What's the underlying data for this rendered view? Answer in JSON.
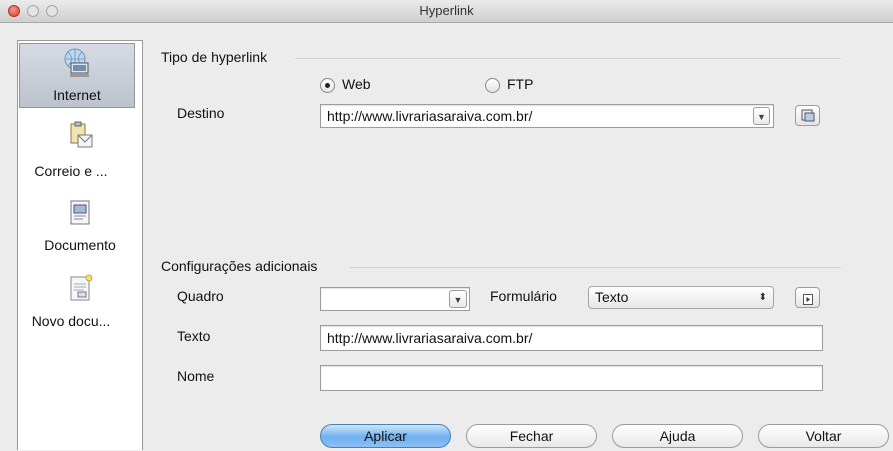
{
  "window": {
    "title": "Hyperlink"
  },
  "sidebar": {
    "items": [
      {
        "label": "Internet",
        "icon": "globe-computer-icon",
        "selected": true
      },
      {
        "label": "Correio e ...",
        "icon": "mail-clipboard-icon",
        "selected": false
      },
      {
        "label": "Documento",
        "icon": "document-icon",
        "selected": false
      },
      {
        "label": "Novo docu...",
        "icon": "new-document-icon",
        "selected": false
      }
    ]
  },
  "hyperlink_type": {
    "section_label": "Tipo de hyperlink",
    "options": [
      {
        "label": "Web",
        "selected": true
      },
      {
        "label": "FTP",
        "selected": false
      }
    ],
    "destination_label": "Destino",
    "destination_value": "http://www.livrariasaraiva.com.br/"
  },
  "additional": {
    "section_label": "Configurações adicionais",
    "frame_label": "Quadro",
    "frame_value": "",
    "form_label": "Formulário",
    "form_value": "Texto",
    "text_label": "Texto",
    "text_value": "http://www.livrariasaraiva.com.br/",
    "name_label": "Nome",
    "name_value": ""
  },
  "buttons": {
    "apply": "Aplicar",
    "close": "Fechar",
    "help": "Ajuda",
    "back": "Voltar"
  },
  "colors": {
    "primary_button": "#6fb0f0",
    "close_light": "#d3402f"
  }
}
